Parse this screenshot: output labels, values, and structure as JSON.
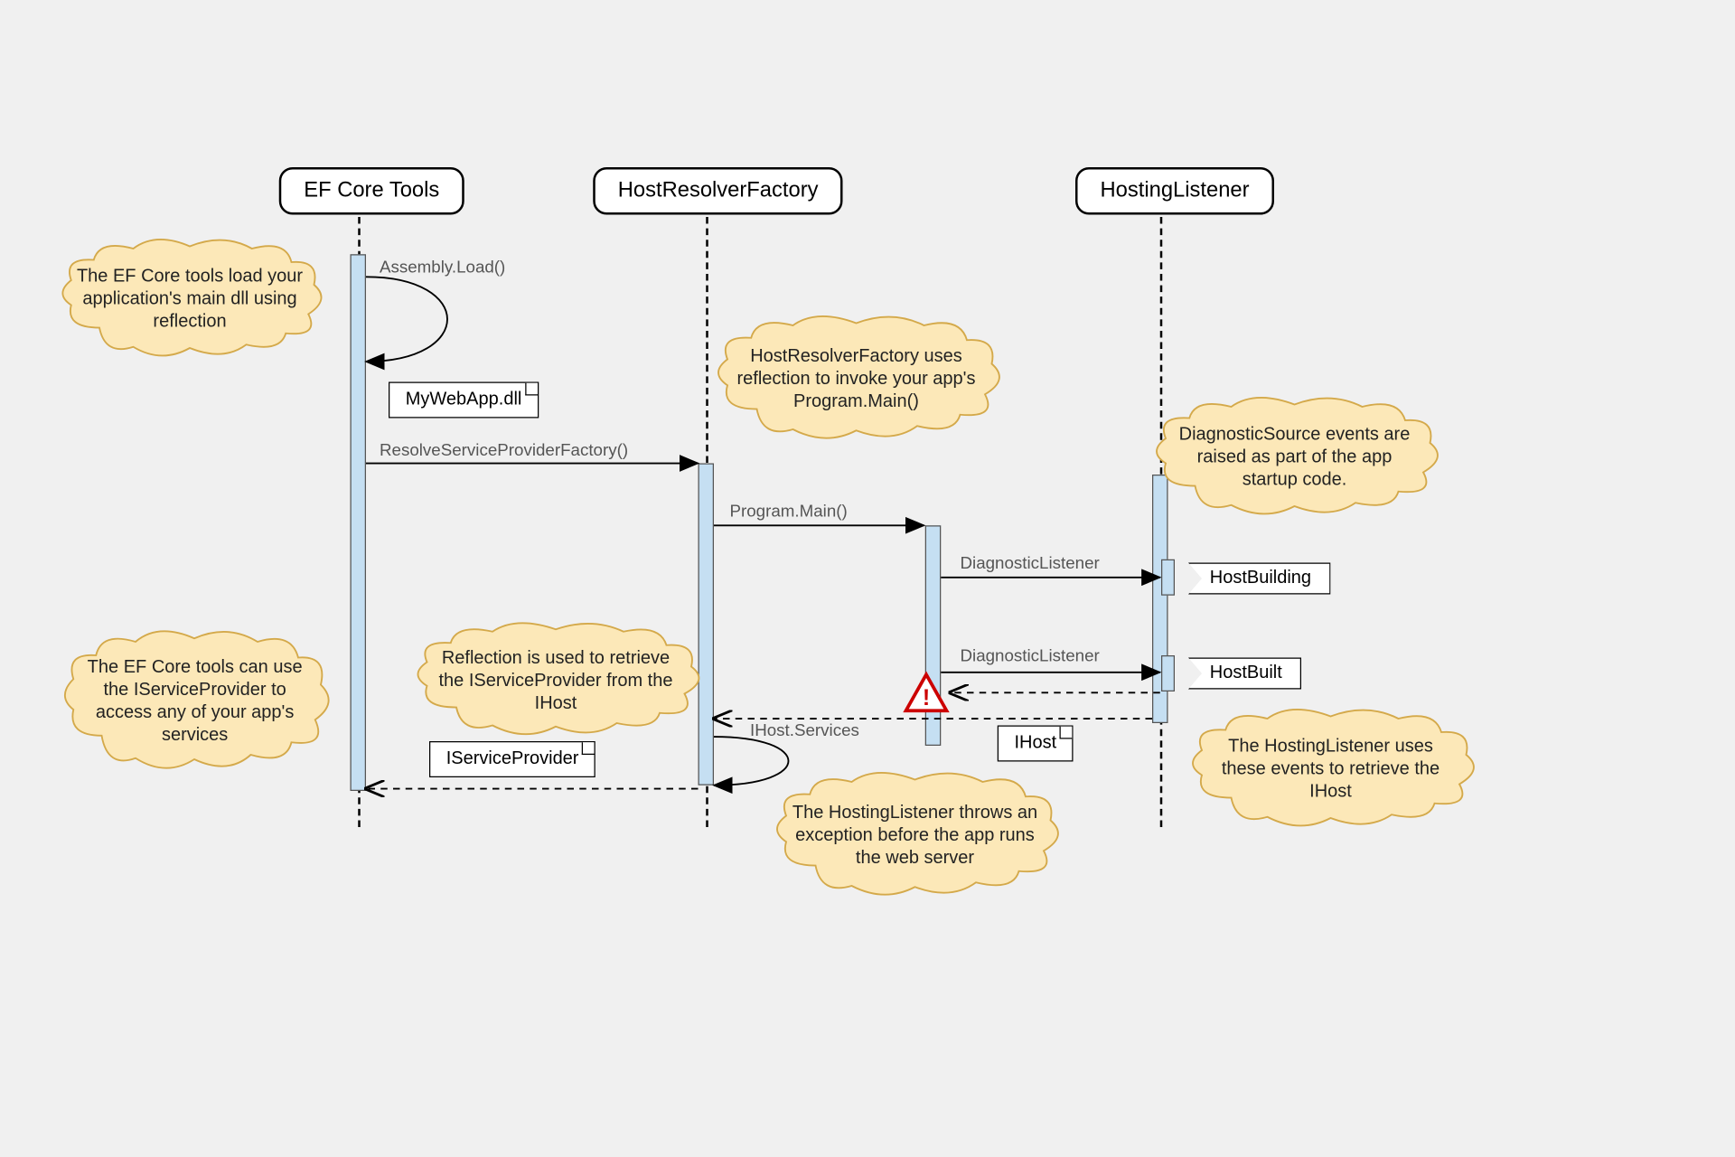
{
  "participants": {
    "p1": "EF Core Tools",
    "p2": "HostResolverFactory",
    "p3": "HostingListener"
  },
  "messages": {
    "assembly_load": "Assembly.Load()",
    "resolve_factory": "ResolveServiceProviderFactory()",
    "program_main": "Program.Main()",
    "diag1": "DiagnosticListener",
    "diag2": "DiagnosticListener",
    "ihost_services": "IHost.Services"
  },
  "notes": {
    "mywebapp": "MyWebApp.dll",
    "iserviceprovider": "IServiceProvider",
    "ihost": "IHost"
  },
  "flags": {
    "hostbuilding": "HostBuilding",
    "hostbuilt": "HostBuilt"
  },
  "clouds": {
    "c1": "The EF Core tools load your application's main dll using reflection",
    "c2": "HostResolverFactory uses reflection to invoke your app's Program.Main()",
    "c3": "DiagnosticSource events are raised as part of the app startup code.",
    "c4": "Reflection is used to retrieve the IServiceProvider from the IHost",
    "c5": "The EF Core tools can use the IServiceProvider to access any of your app's services",
    "c6": "The HostingListener uses these events to retrieve the IHost",
    "c7": "The HostingListener throws an exception before the app runs the web server"
  }
}
